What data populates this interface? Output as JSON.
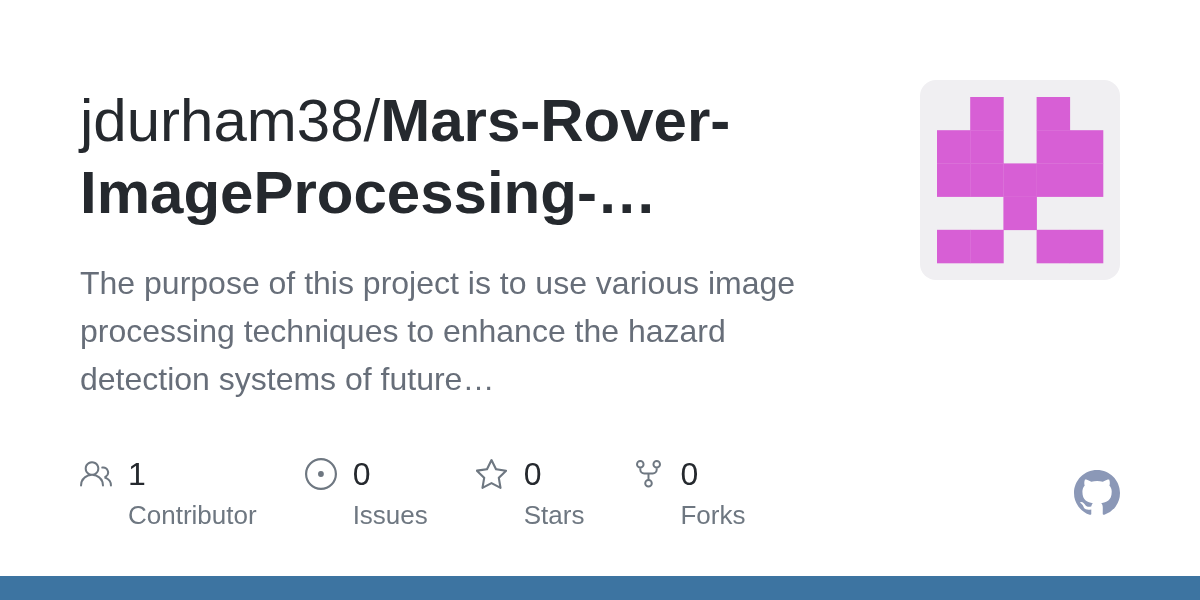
{
  "title": "jdurham38/**Mars-Rover-ImageProcessing-…**",
  "description": "The purpose of this project is to use various image processing techniques to enhance the hazard detection systems of future…",
  "stats": [
    {
      "kind": "contributors",
      "count": "1",
      "label": "Contributor"
    },
    {
      "kind": "issues",
      "count": "0",
      "label": "Issues"
    },
    {
      "kind": "stars",
      "count": "0",
      "label": "Stars"
    },
    {
      "kind": "forks",
      "count": "0",
      "label": "Forks"
    }
  ],
  "language_bar": [
    {
      "color": "#3d74a1",
      "level": 1
    }
  ]
}
